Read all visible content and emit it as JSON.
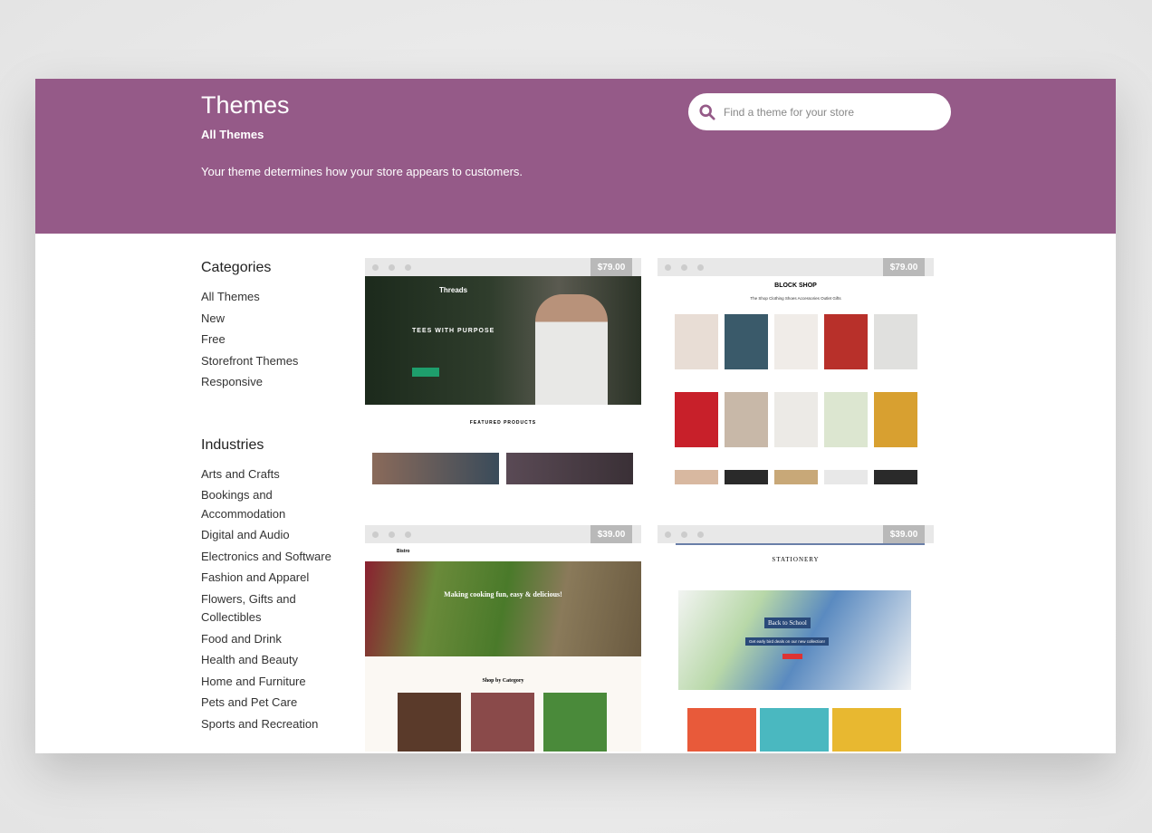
{
  "header": {
    "title": "Themes",
    "subtitle": "All Themes",
    "description": "Your theme determines how your store appears to customers.",
    "search_placeholder": "Find a theme for your store"
  },
  "sidebar": {
    "categories_heading": "Categories",
    "categories": [
      "All Themes",
      "New",
      "Free",
      "Storefront Themes",
      "Responsive"
    ],
    "industries_heading": "Industries",
    "industries": [
      "Arts and Crafts",
      "Bookings and Accommodation",
      "Digital and Audio",
      "Electronics and Software",
      "Fashion and Apparel",
      "Flowers, Gifts and Collectibles",
      "Food and Drink",
      "Health and Beauty",
      "Home and Furniture",
      "Pets and Pet Care",
      "Sports and Recreation"
    ]
  },
  "themes": [
    {
      "price": "$79.00",
      "brand": "Threads",
      "headline": "TEES WITH PURPOSE",
      "section": "FEATURED PRODUCTS"
    },
    {
      "price": "$79.00",
      "brand": "BLOCK SHOP",
      "nav": "The Shop  Clothing  Shoes  Accessories  Outlet  Gifts"
    },
    {
      "price": "$39.00",
      "brand": "Bistro",
      "headline": "Making cooking fun, easy & delicious!",
      "section": "Shop by Category"
    },
    {
      "price": "$39.00",
      "brand": "STATIONERY",
      "headline": "Back to School",
      "tagline": "Get early bird deals on our new collection!"
    }
  ],
  "colors": {
    "header": "#955a88",
    "accent_green": "#1e9e6c"
  }
}
